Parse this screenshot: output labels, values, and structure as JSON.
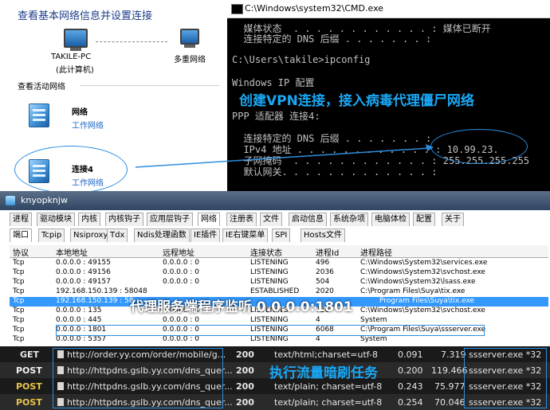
{
  "network_center": {
    "title": "查看基本网络信息并设置连接",
    "local_pc": {
      "name": "TAKILE-PC",
      "sub": "(此计算机)"
    },
    "multi_network": "多重网络",
    "active_label": "查看活动网络",
    "networks": [
      {
        "name": "网络",
        "type": "工作网络"
      },
      {
        "name": "连接4",
        "type": "工作网络"
      }
    ]
  },
  "cmd": {
    "title": "C:\\Windows\\system32\\CMD.exe",
    "lines": [
      "  媒体状态  . . . . . . . . . . . . : 媒体已断开",
      "  连接特定的 DNS 后缀 . . . . . . . :",
      "",
      "C:\\Users\\takile>ipconfig",
      "",
      "Windows IP 配置",
      "",
      "",
      "PPP 适配器 连接4:",
      "",
      "  连接特定的 DNS 后缀 . . . . . . . :",
      "  IPv4 地址 . . . . . . . . . . . . : 10.99.23.",
      "  子网掩码  . . . . . . . . . . . . : 255.255.255.255",
      "  默认网关. . . . . . . . . . . . . :"
    ],
    "overlay": "创建VPN连接，接入病毒代理僵尸网络"
  },
  "tool": {
    "title": "knyopknjw",
    "main_tabs": [
      "进程",
      "驱动模块",
      "内核",
      "内核钩子",
      "应用层钩子",
      "网络",
      "注册表",
      "文件",
      "启动信息",
      "系统杂项",
      "电脑体检",
      "配置",
      "关于"
    ],
    "selected_main_tab": "网络",
    "sub_tabs": [
      "端口",
      "Tcpip",
      "Nsiproxy",
      "Tdx",
      "Ndis处理函数",
      "IE插件",
      "IE右键菜单",
      "SPI",
      "Hosts文件"
    ],
    "selected_sub_tab": "端口",
    "columns": [
      "协议",
      "本地地址",
      "远程地址",
      "连接状态",
      "进程Id",
      "进程路径"
    ],
    "rows": [
      [
        "Tcp",
        "0.0.0.0 : 49155",
        "0.0.0.0 : 0",
        "LISTENING",
        "496",
        "C:\\Windows\\System32\\services.exe"
      ],
      [
        "Tcp",
        "0.0.0.0 : 49156",
        "0.0.0.0 : 0",
        "LISTENING",
        "2036",
        "C:\\Windows\\System32\\svchost.exe"
      ],
      [
        "Tcp",
        "0.0.0.0 : 49157",
        "0.0.0.0 : 0",
        "LISTENING",
        "504",
        "C:\\Windows\\System32\\lsass.exe"
      ],
      [
        "Tcp",
        "192.168.150.139 : 58048",
        "",
        "ESTABLISHED",
        "2020",
        "C:\\Program Files\\Suya\\tix.exe"
      ],
      [
        "Tcp",
        "192.168.150.139 : 58",
        "",
        "",
        "",
        "Program Files\\Suya\\tix.exe"
      ],
      [
        "Tcp",
        "0.0.0.0 : 135",
        "0.0.0.0 : 0",
        "LISTENING",
        "720",
        "C:\\Windows\\System32\\svchost.exe"
      ],
      [
        "Tcp",
        "0.0.0.0 : 445",
        "0.0.0.0 : 0",
        "LISTENING",
        "4",
        "System"
      ],
      [
        "Tcp",
        "0.0.0.0 : 1801",
        "0.0.0.0 : 0",
        "LISTENING",
        "6068",
        "C:\\Program Files\\Suya\\ssserver.exe"
      ],
      [
        "Tcp",
        "0.0.0.0 : 5357",
        "0.0.0.0 : 0",
        "LISTENING",
        "4",
        "System"
      ]
    ],
    "overlay": "代理服务端程序监听 0.0.0.0:1801"
  },
  "fiddler": {
    "rows": [
      {
        "method": "GET",
        "url": "http://order.yy.com/order/mobile/g...",
        "code": "200",
        "type": "text/html;charset=utf-8",
        "time": "0.091",
        "size": "7.319",
        "process": "ssserver.exe *32"
      },
      {
        "method": "POST",
        "url": "http://httpdns.gslb.yy.com/dns_quer...",
        "code": "200",
        "type": "",
        "time": "0.200",
        "size": "119.466",
        "process": "ssserver.exe *32"
      },
      {
        "method": "POST",
        "url": "http://httpdns.gslb.yy.com/dns_quer...",
        "code": "200",
        "type": "text/plain; charset=utf-8",
        "time": "0.243",
        "size": "75.977",
        "process": "ssserver.exe *32"
      },
      {
        "method": "POST",
        "url": "http://httpdns.gslb.yy.com/dns_quer...",
        "code": "200",
        "type": "text/plain; charset=utf-8",
        "time": "0.254",
        "size": "70.046",
        "process": "ssserver.exe *32"
      }
    ],
    "overlay": "执行流量暗刷任务"
  },
  "colors": {
    "annotation": "#2c8ee0",
    "overlay_text": "#19a8f5",
    "selection": "#3399ff"
  }
}
